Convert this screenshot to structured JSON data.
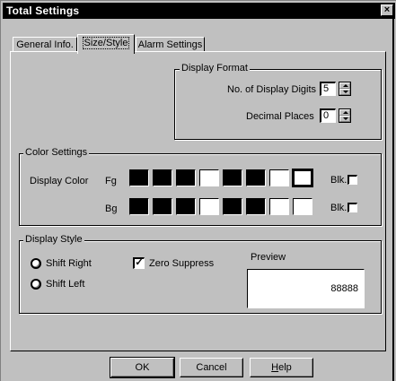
{
  "window": {
    "title": "Total Settings"
  },
  "tabs": [
    {
      "label": "General Info."
    },
    {
      "label": "Size/Style"
    },
    {
      "label": "Alarm Settings"
    }
  ],
  "display_format": {
    "label": "Display Format",
    "digits_label": "No. of Display Digits",
    "digits_value": "5",
    "decimal_label": "Decimal Places",
    "decimal_value": "0"
  },
  "color_settings": {
    "label": "Color Settings",
    "display_color_label": "Display Color",
    "fg_label": "Fg",
    "bg_label": "Bg",
    "blk_label": "Blk.",
    "fg_colors": [
      "#000000",
      "#000000",
      "#000000",
      "#ffffff",
      "#000000",
      "#000000",
      "#ffffff",
      "#ffffff"
    ],
    "bg_colors": [
      "#000000",
      "#000000",
      "#000000",
      "#ffffff",
      "#000000",
      "#000000",
      "#ffffff",
      "#ffffff"
    ],
    "fg_selected": 7
  },
  "display_style": {
    "label": "Display Style",
    "shift_right": "Shift Right",
    "shift_left": "Shift Left",
    "zero_suppress": "Zero Suppress",
    "zero_suppress_checked": true,
    "preview_label": "Preview",
    "preview_value": "88888"
  },
  "buttons": {
    "ok": "OK",
    "cancel": "Cancel",
    "help_prefix": "",
    "help_underlined": "H",
    "help_rest": "elp"
  }
}
